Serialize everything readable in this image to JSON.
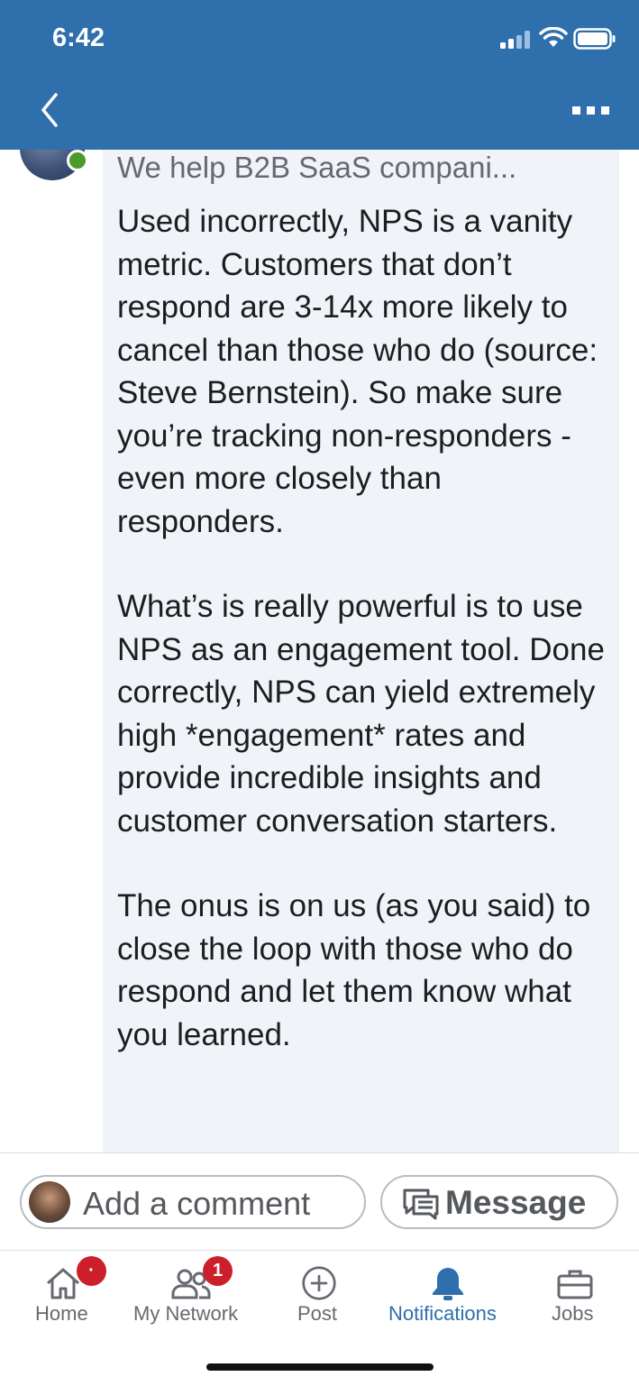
{
  "status_bar": {
    "time": "6:42"
  },
  "nav": {
    "back_icon": "chevron-left-icon",
    "more_icon": "more-horizontal-icon"
  },
  "comment": {
    "author_headline": "We help B2B SaaS compani...",
    "paragraphs": [
      "Used incorrectly, NPS is a vanity metric. Customers that don’t respond are 3-14x more likely to cancel than those who do (source: Steve Bernstein). So make sure you’re tracking non-responders - even more closely than responders.",
      "What’s is really powerful is to use NPS as an engagement tool. Done correctly, NPS can yield extremely high *engagement* rates and provide incredible insights and customer conversation starters.",
      "The onus is on us (as you said) to close the loop with those who do respond and let them know what you learned."
    ]
  },
  "composer": {
    "add_comment_placeholder": "Add a comment",
    "message_label": "Message"
  },
  "tabbar": {
    "items": [
      {
        "label": "Home",
        "icon": "home-icon",
        "badge": "·",
        "active": false
      },
      {
        "label": "My Network",
        "icon": "network-icon",
        "badge": "1",
        "active": false
      },
      {
        "label": "Post",
        "icon": "plus-circle-icon",
        "badge": null,
        "active": false
      },
      {
        "label": "Notifications",
        "icon": "bell-icon",
        "badge": null,
        "active": true
      },
      {
        "label": "Jobs",
        "icon": "briefcase-icon",
        "badge": null,
        "active": false
      }
    ]
  },
  "colors": {
    "brand_blue": "#2e6fac",
    "badge_red": "#cc1f2b",
    "online_green": "#4c9a2a",
    "bubble_bg": "#f0f4f8"
  }
}
